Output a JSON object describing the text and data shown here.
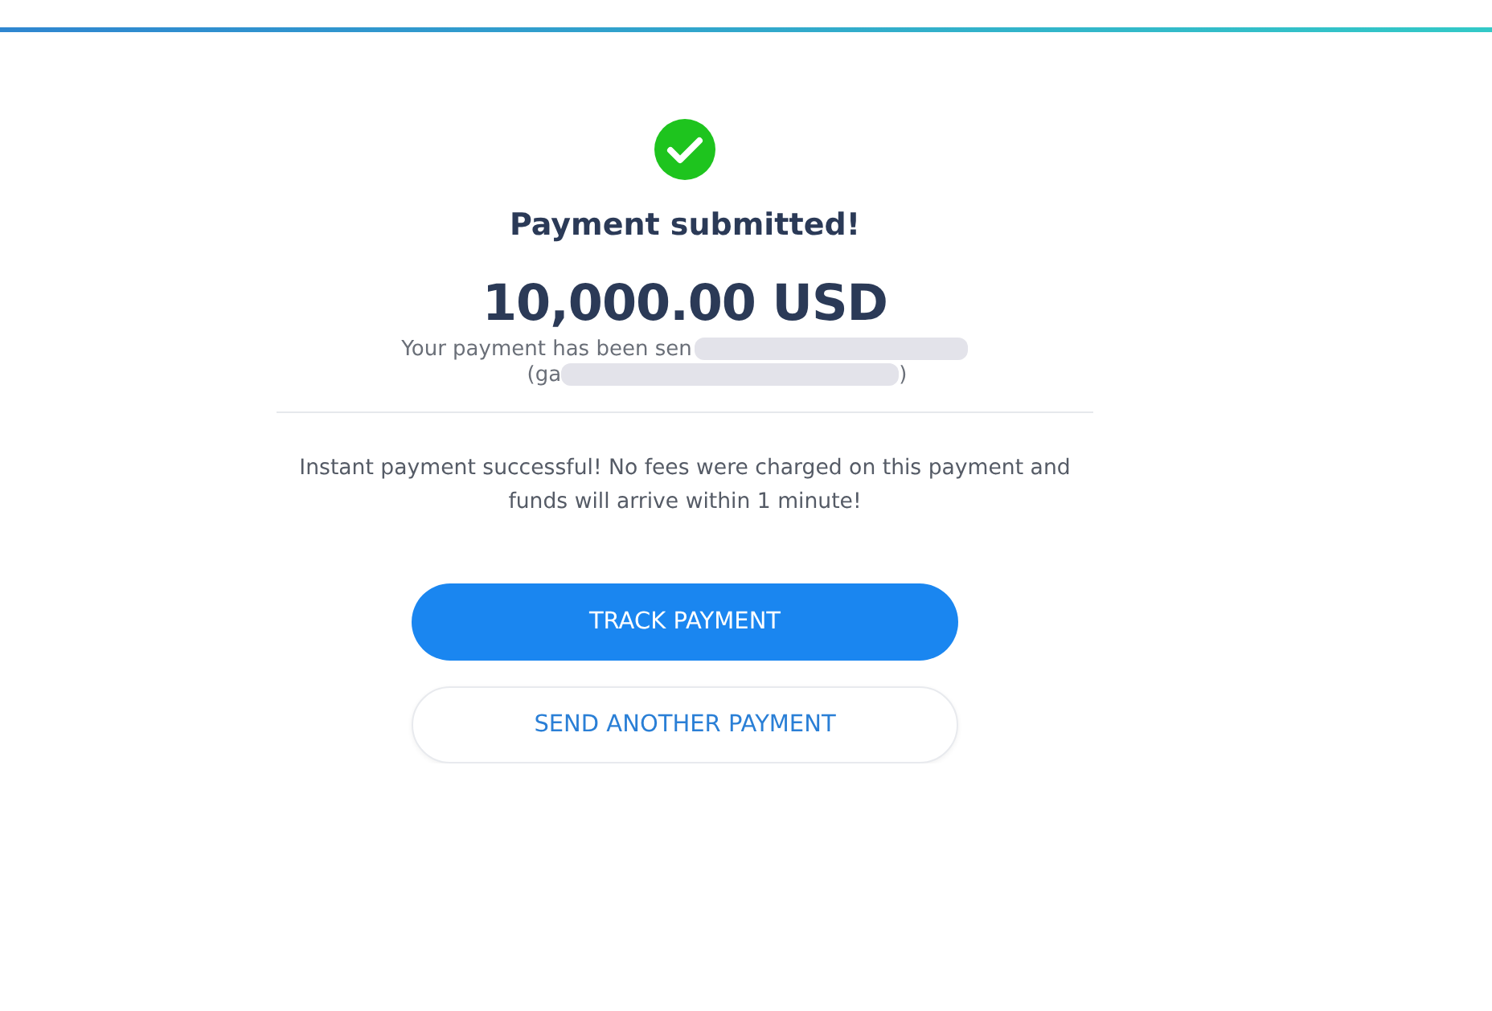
{
  "title": "Payment submitted!",
  "amount": "10,000.00 USD",
  "recipient_line": "Your payment has been sen",
  "recipient_line_2_start": "(ga",
  "recipient_line_2_end": ")",
  "note": "Instant payment successful! No fees were charged on this payment and funds will arrive within 1 minute!",
  "buttons": [
    {
      "label": "TRACK PAYMENT",
      "kind": "primary"
    },
    {
      "label": "SEND ANOTHER PAYMENT",
      "kind": "secondary"
    }
  ]
}
